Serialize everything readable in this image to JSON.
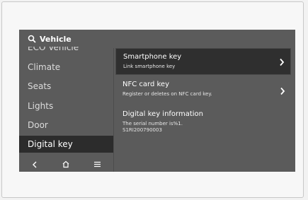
{
  "header": {
    "title": "Vehicle",
    "icon": "search-icon"
  },
  "sidebar": {
    "items": [
      {
        "label": "ECO Vehicle"
      },
      {
        "label": "Climate"
      },
      {
        "label": "Seats"
      },
      {
        "label": "Lights"
      },
      {
        "label": "Door"
      },
      {
        "label": "Digital key"
      }
    ],
    "selected": "Digital key"
  },
  "nav": {
    "icons": [
      "back-icon",
      "home-icon",
      "menu-icon"
    ]
  },
  "content": {
    "rows": [
      {
        "title": "Smartphone key",
        "subtitle": "Link smartphone key",
        "selected": true
      },
      {
        "title": "NFC card key",
        "subtitle": "Register or deletes on NFC card key."
      },
      {
        "title": "Digital key information",
        "subtitle": "The serial number is%1.",
        "subtitle2": "S1RI200790003"
      }
    ]
  },
  "colors": {
    "screen": "#5b5b5b",
    "selected": "#2c2c2c",
    "text": "#ffffff"
  }
}
